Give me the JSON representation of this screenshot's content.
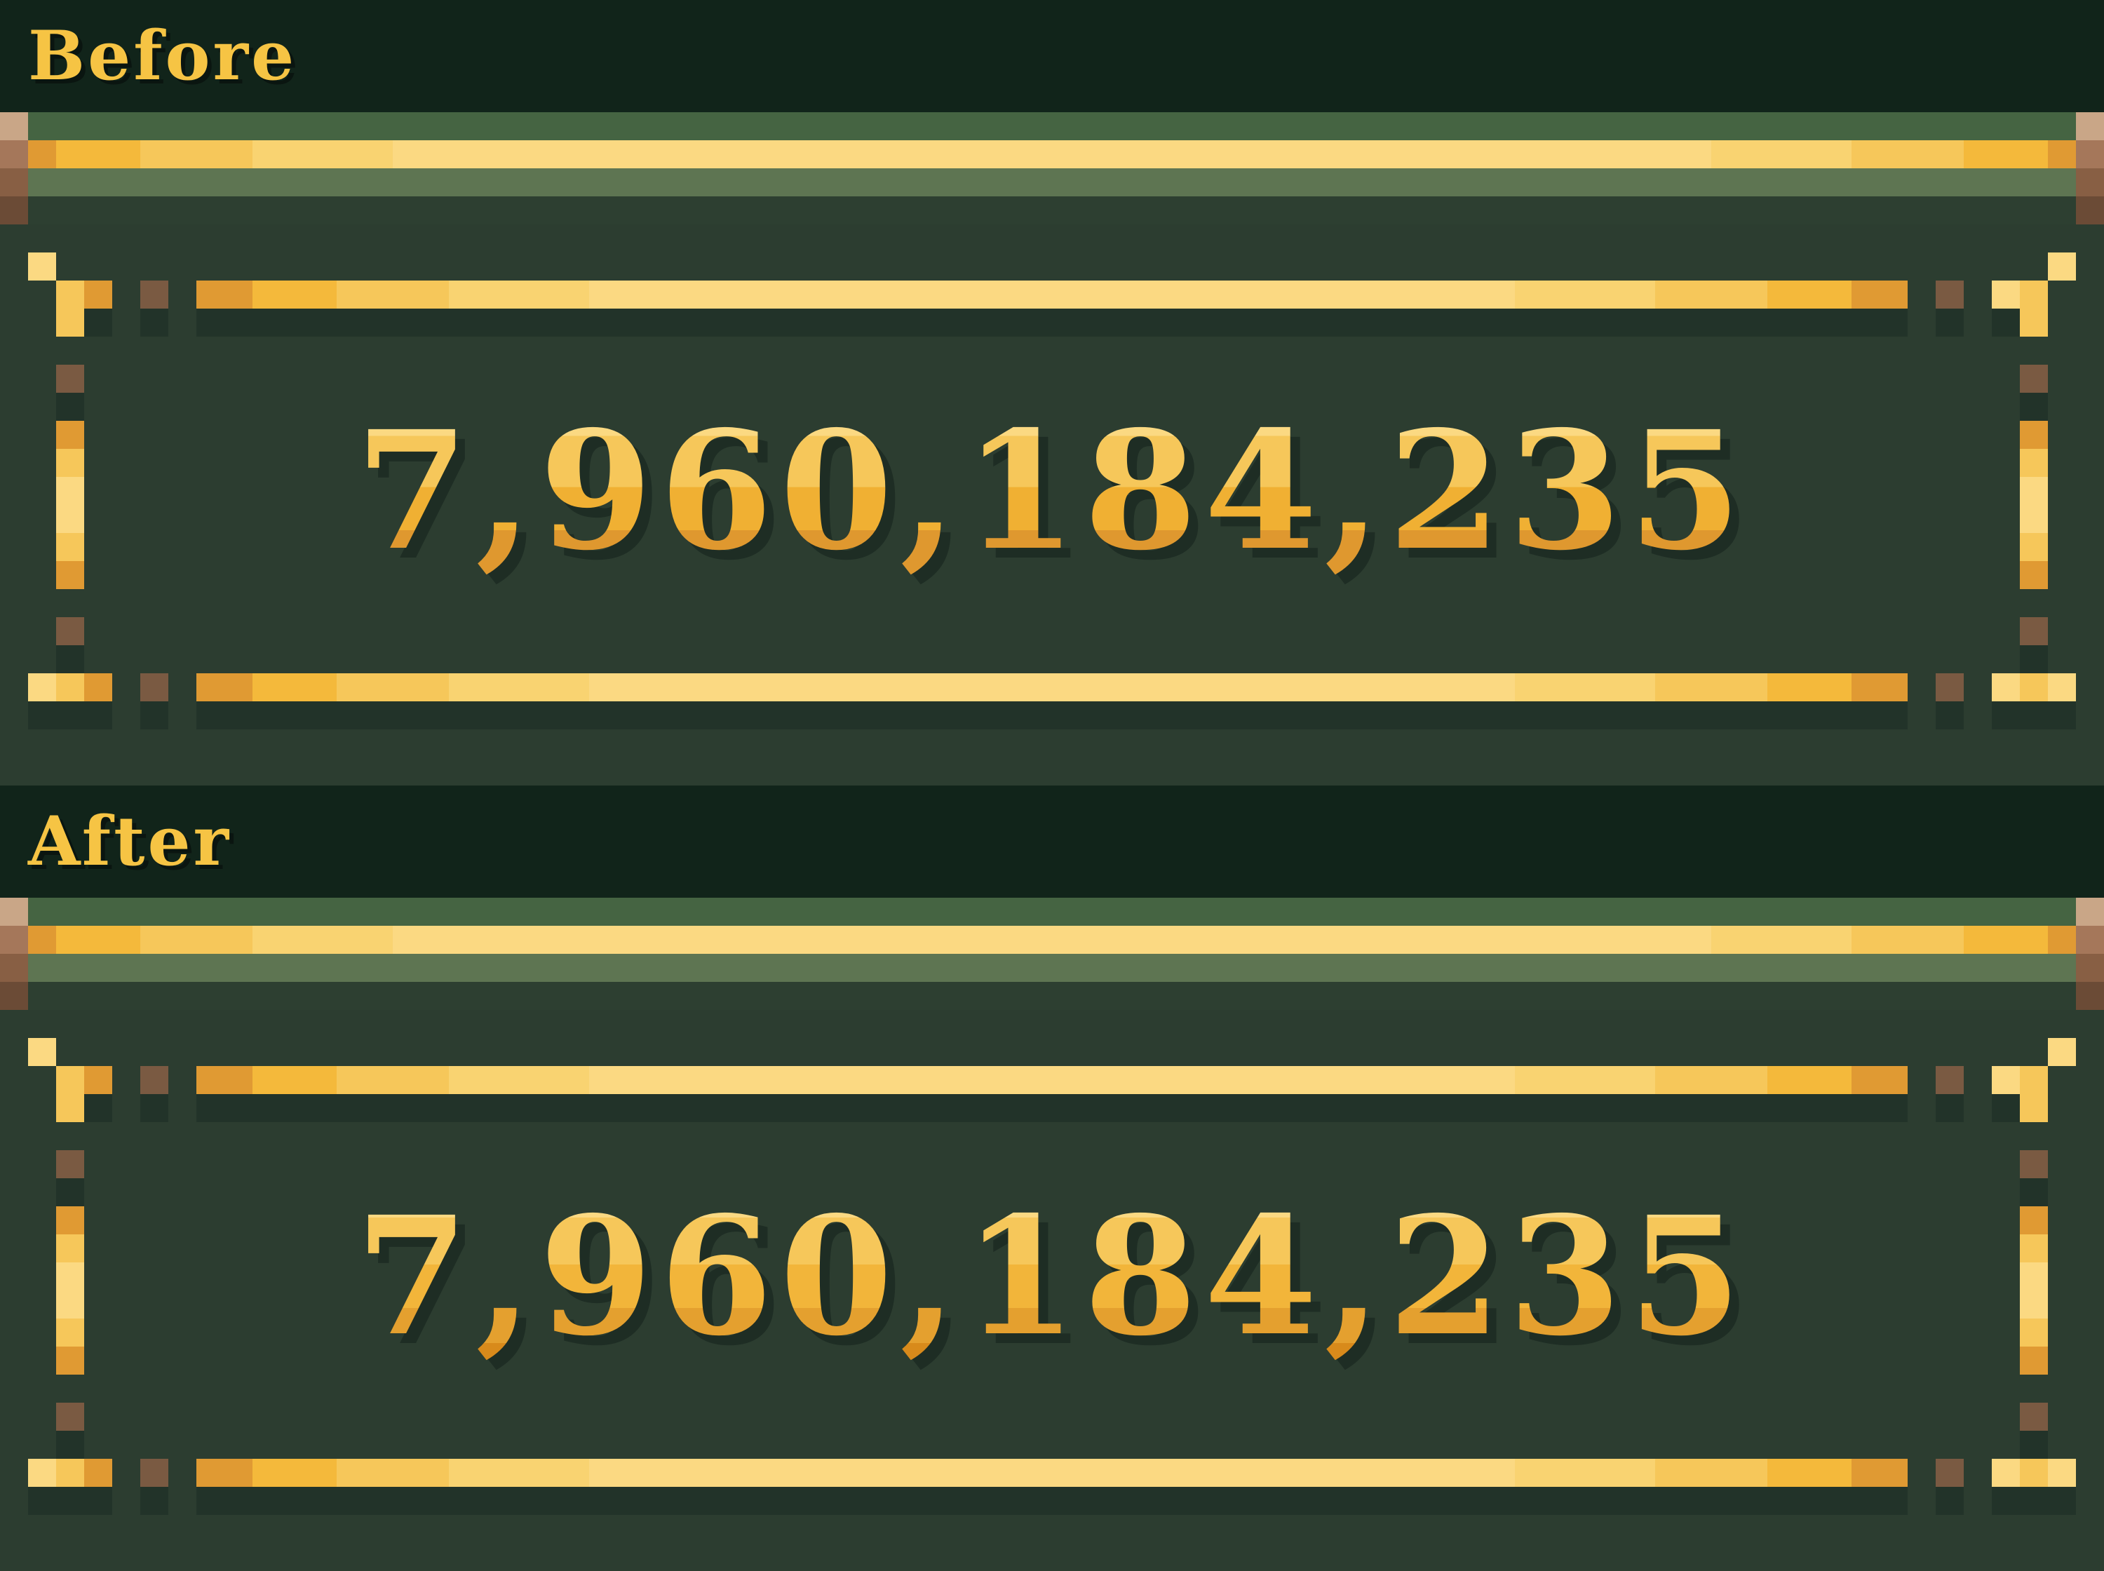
{
  "sections": {
    "before": {
      "label": "Before",
      "counter_value": "7,960,184,235"
    },
    "after": {
      "label": "After",
      "counter_value": "7,960,184,235"
    }
  },
  "colors": {
    "background": "#2c3d30",
    "header_band": "#11241a",
    "gold": "#f6c444",
    "gold_light": "#fbd982",
    "gold_dark": "#e09a33",
    "rail_green": "#456442",
    "rail_green_light": "#5e7552",
    "rivet_brown": "#7a5a42"
  }
}
